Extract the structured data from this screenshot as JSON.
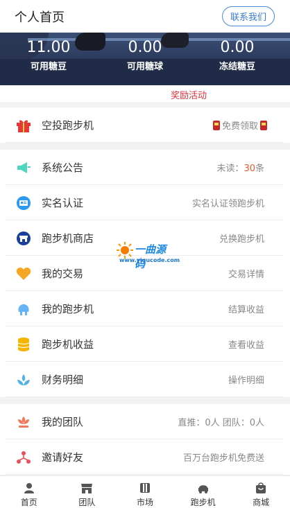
{
  "header": {
    "title": "个人首页",
    "contact_label": "联系我们"
  },
  "stats": [
    {
      "value": "11.00",
      "label": "可用糖豆"
    },
    {
      "value": "0.00",
      "label": "可用糖球"
    },
    {
      "value": "0.00",
      "label": "冻结糖豆"
    }
  ],
  "activity_label": "奖励活动",
  "menu": [
    {
      "label": "空投跑步机",
      "right": "免费领取",
      "icon": "gift-icon"
    },
    {
      "label": "系统公告",
      "right_prefix": "未读：",
      "right_count": "30",
      "right_suffix": "条",
      "icon": "megaphone-icon"
    },
    {
      "label": "实名认证",
      "right": "实名认证领跑步机",
      "icon": "id-card-icon"
    },
    {
      "label": "跑步机商店",
      "right": "兑换跑步机",
      "icon": "store-icon"
    },
    {
      "label": "我的交易",
      "right": "交易详情",
      "icon": "heart-icon"
    },
    {
      "label": "我的跑步机",
      "right": "结算收益",
      "icon": "treadmill-icon"
    },
    {
      "label": "跑步机收益",
      "right": "查看收益",
      "icon": "coins-icon"
    },
    {
      "label": "财务明细",
      "right": "操作明细",
      "icon": "finance-icon"
    },
    {
      "label": "我的团队",
      "right": "直推：0人 团队：0人",
      "icon": "team-icon"
    },
    {
      "label": "邀请好友",
      "right": "百万台跑步机免费送",
      "icon": "share-icon"
    }
  ],
  "watermark": {
    "title": "一曲源码",
    "url": "www.yiqucode.com"
  },
  "tabs": [
    {
      "label": "首页",
      "icon": "user-icon"
    },
    {
      "label": "团队",
      "icon": "shop-icon"
    },
    {
      "label": "市场",
      "icon": "market-icon"
    },
    {
      "label": "跑步机",
      "icon": "treadmill-icon"
    },
    {
      "label": "商城",
      "icon": "bag-icon"
    }
  ],
  "colors": {
    "accent": "#3a7bd5",
    "alert": "#e0313a",
    "count": "#e05b2a"
  }
}
